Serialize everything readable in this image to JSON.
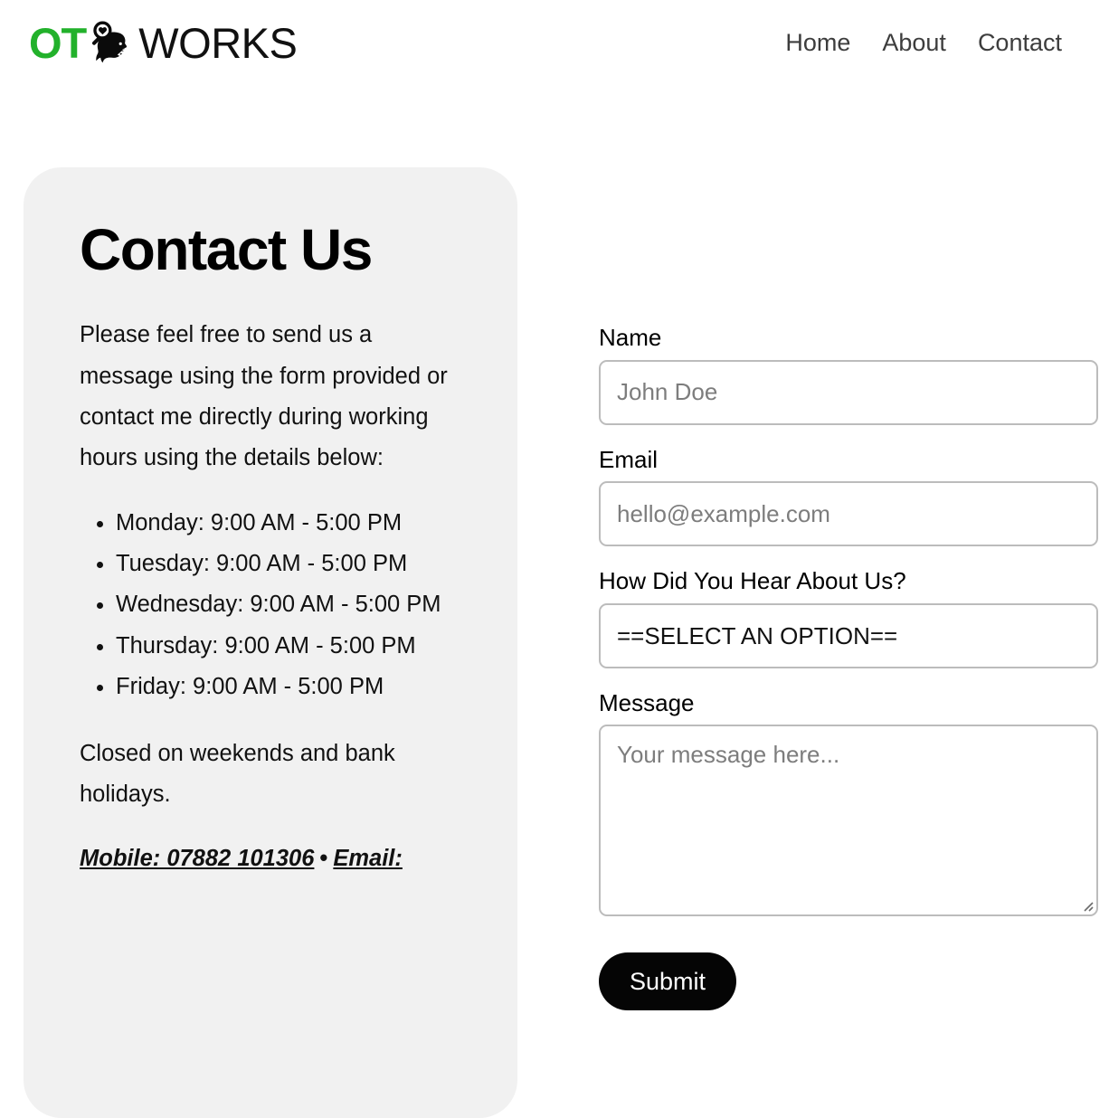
{
  "header": {
    "brand": {
      "ot_text": "OT",
      "works_text": "WORKS",
      "mark_icon": "head-magnifier-heart-icon",
      "ot_color": "#22b12b"
    },
    "nav": [
      {
        "label": "Home",
        "name": "nav-link-home"
      },
      {
        "label": "About",
        "name": "nav-link-about"
      },
      {
        "label": "Contact",
        "name": "nav-link-contact"
      }
    ]
  },
  "info_card": {
    "title": "Contact Us",
    "intro": "Please feel free to send us a message using the form provided or contact me directly during working hours using the details below:",
    "hours": [
      "Monday: 9:00 AM - 5:00 PM",
      "Tuesday: 9:00 AM - 5:00 PM",
      "Wednesday: 9:00 AM - 5:00 PM",
      "Thursday: 9:00 AM - 5:00 PM",
      "Friday: 9:00 AM - 5:00 PM"
    ],
    "closed_note": "Closed on weekends and bank holidays.",
    "contact": {
      "mobile_label": "Mobile: 07882 101306",
      "separator": "•",
      "email_label": "Email:"
    },
    "background_color": "#f1f1f1"
  },
  "form": {
    "name": {
      "label": "Name",
      "placeholder": "John Doe",
      "value": ""
    },
    "email": {
      "label": "Email",
      "placeholder": "hello@example.com",
      "value": ""
    },
    "source": {
      "label": "How Did You Hear About Us?",
      "selected": "==SELECT AN OPTION=="
    },
    "message": {
      "label": "Message",
      "placeholder": "Your message here...",
      "value": ""
    },
    "submit_label": "Submit",
    "submit_color": "#050505"
  }
}
